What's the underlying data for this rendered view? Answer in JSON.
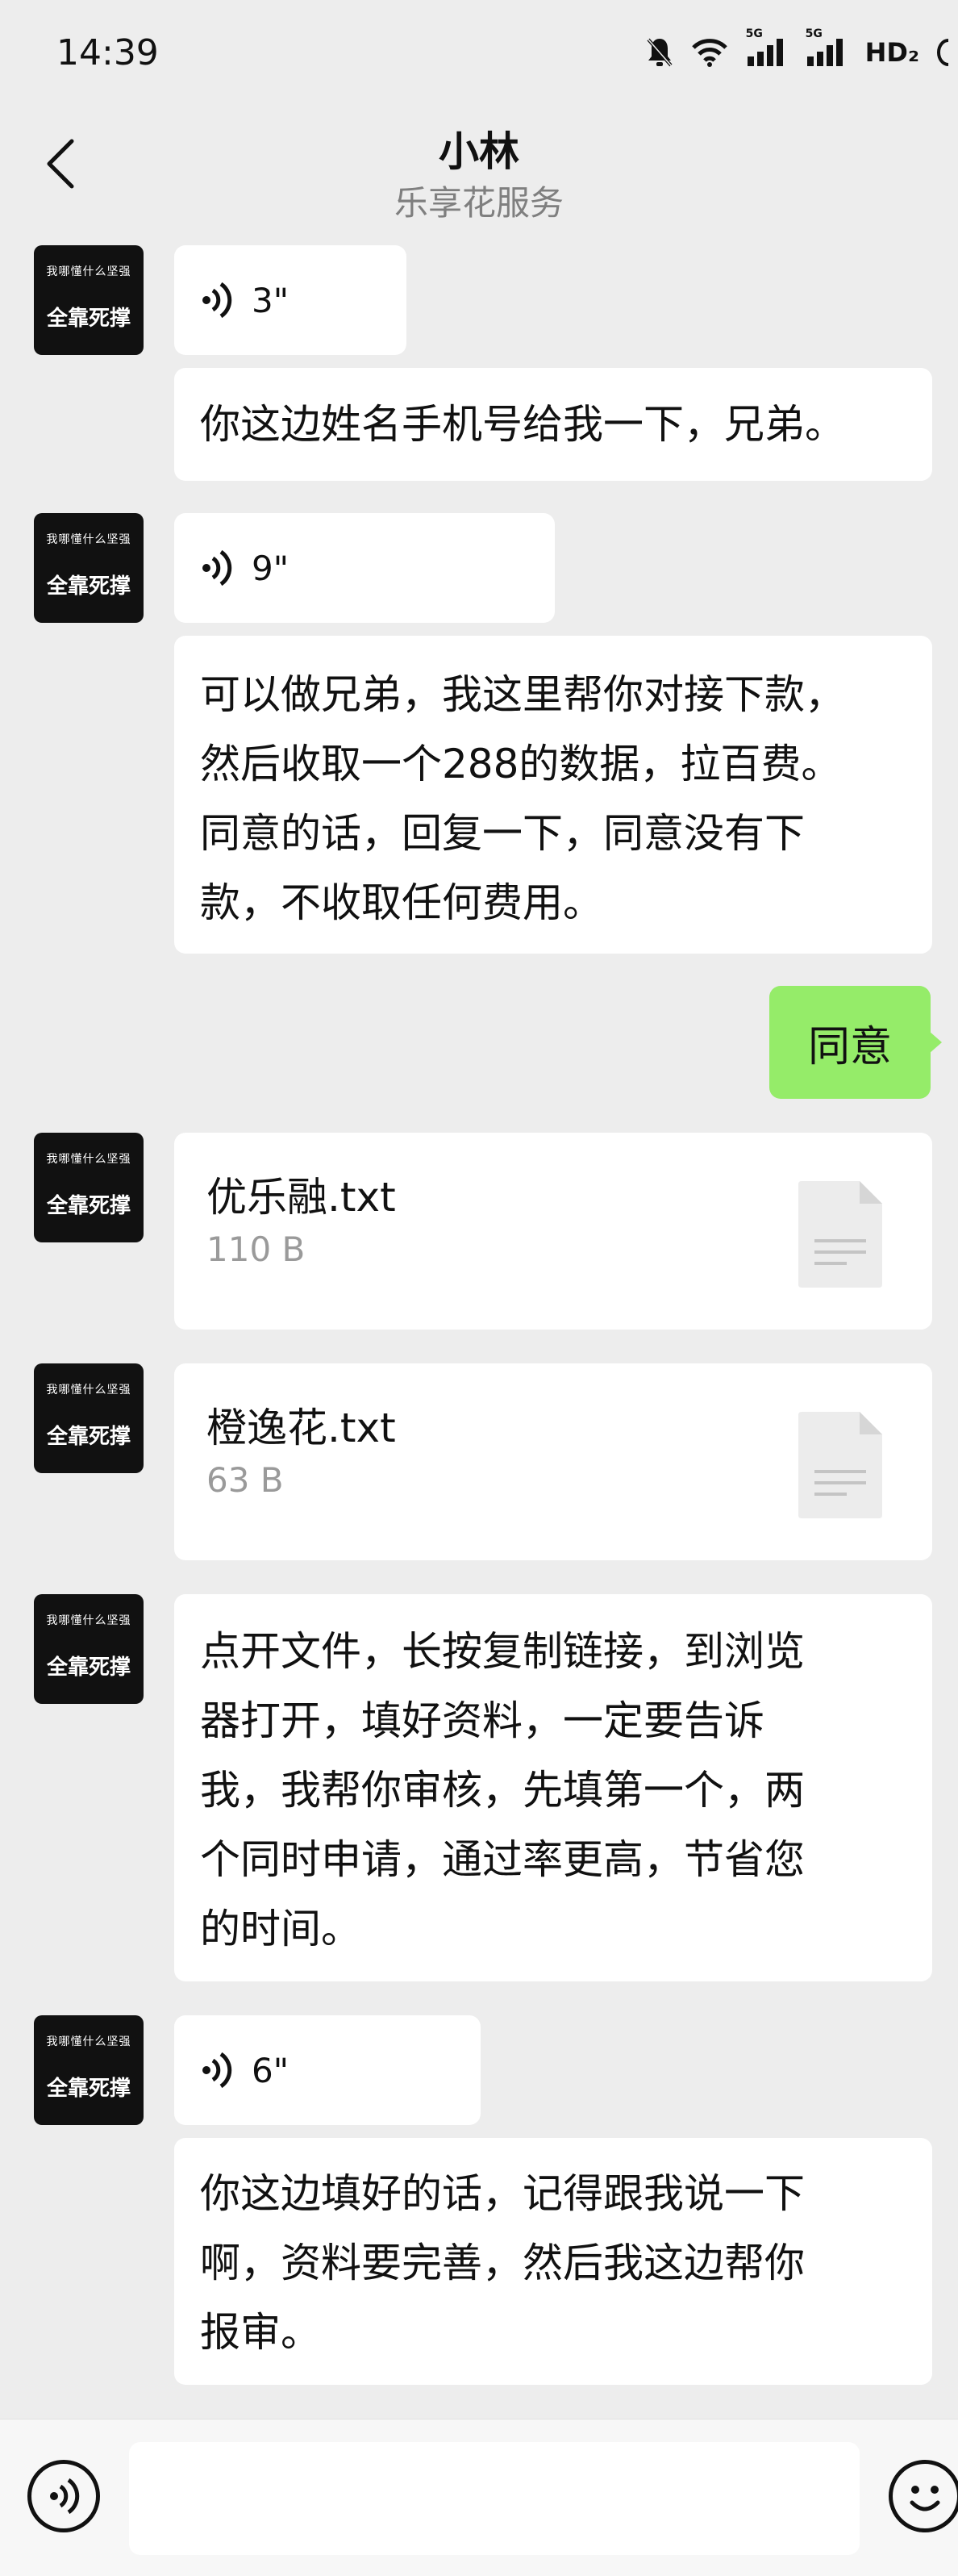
{
  "status_bar": {
    "time": "14:39",
    "network1": "5G",
    "network2": "5G",
    "hd": "HD₂"
  },
  "header": {
    "title": "小林",
    "subtitle": "乐享花服务"
  },
  "avatar": {
    "top_text": "我哪懂什么坚强",
    "bottom_text": "全靠死撑"
  },
  "messages": [
    {
      "type": "voice",
      "duration": "3\""
    },
    {
      "type": "text",
      "lines": [
        "你这边姓名手机号给我一下，兄弟。"
      ]
    },
    {
      "type": "voice",
      "duration": "9\""
    },
    {
      "type": "text",
      "lines": [
        "可以做兄弟，我这里帮你对接下款，",
        "然后收取一个288的数据，拉百费。",
        "同意的话，回复一下，同意没有下",
        "款，不收取任何费用。"
      ]
    },
    {
      "type": "sent",
      "text": "同意"
    },
    {
      "type": "file",
      "name": "优乐融.txt",
      "size": "110 B"
    },
    {
      "type": "file",
      "name": "橙逸花.txt",
      "size": "63 B"
    },
    {
      "type": "text",
      "lines": [
        "点开文件，长按复制链接，到浏览",
        "器打开，填好资料，一定要告诉",
        "我，我帮你审核，先填第一个，两",
        "个同时申请，通过率更高，节省您",
        "的时间。"
      ]
    },
    {
      "type": "voice",
      "duration": "6\""
    },
    {
      "type": "text",
      "lines": [
        "你这边填好的话，记得跟我说一下",
        "啊，资料要完善，然后我这边帮你",
        "报审。"
      ]
    }
  ],
  "input": {
    "placeholder": ""
  }
}
